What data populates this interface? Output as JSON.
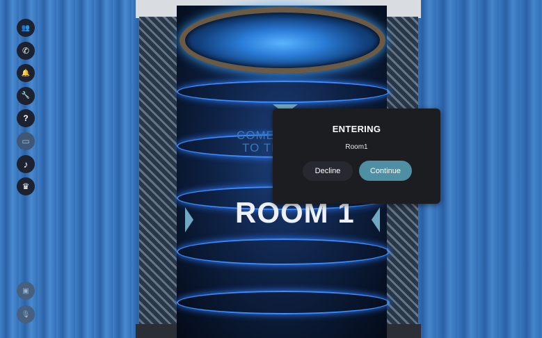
{
  "toolbar": {
    "items": [
      {
        "name": "people-icon",
        "glyph": "👥"
      },
      {
        "name": "phone-icon",
        "glyph": "✆"
      },
      {
        "name": "bell-icon",
        "glyph": "🔔"
      },
      {
        "name": "wrench-icon",
        "glyph": "🔧"
      },
      {
        "name": "help-icon",
        "glyph": "?"
      },
      {
        "name": "laptop-icon",
        "glyph": "▭"
      },
      {
        "name": "music-icon",
        "glyph": "♪"
      },
      {
        "name": "crown-icon",
        "glyph": "♛"
      }
    ],
    "bottom": [
      {
        "name": "camera-off-icon",
        "glyph": "▣"
      },
      {
        "name": "mic-off-icon",
        "glyph": "🎙"
      }
    ]
  },
  "scene": {
    "welcome_line1": "COME",
    "welcome_line2": "TO TE",
    "room_sign": "ROOM 1"
  },
  "dialog": {
    "title": "ENTERING",
    "room": "Room1",
    "decline_label": "Decline",
    "continue_label": "Continue"
  },
  "colors": {
    "curtain": "#3a78c0",
    "dialog_bg": "#1c1d20",
    "continue_button": "#4f8fa3",
    "decline_button": "#262a30"
  }
}
